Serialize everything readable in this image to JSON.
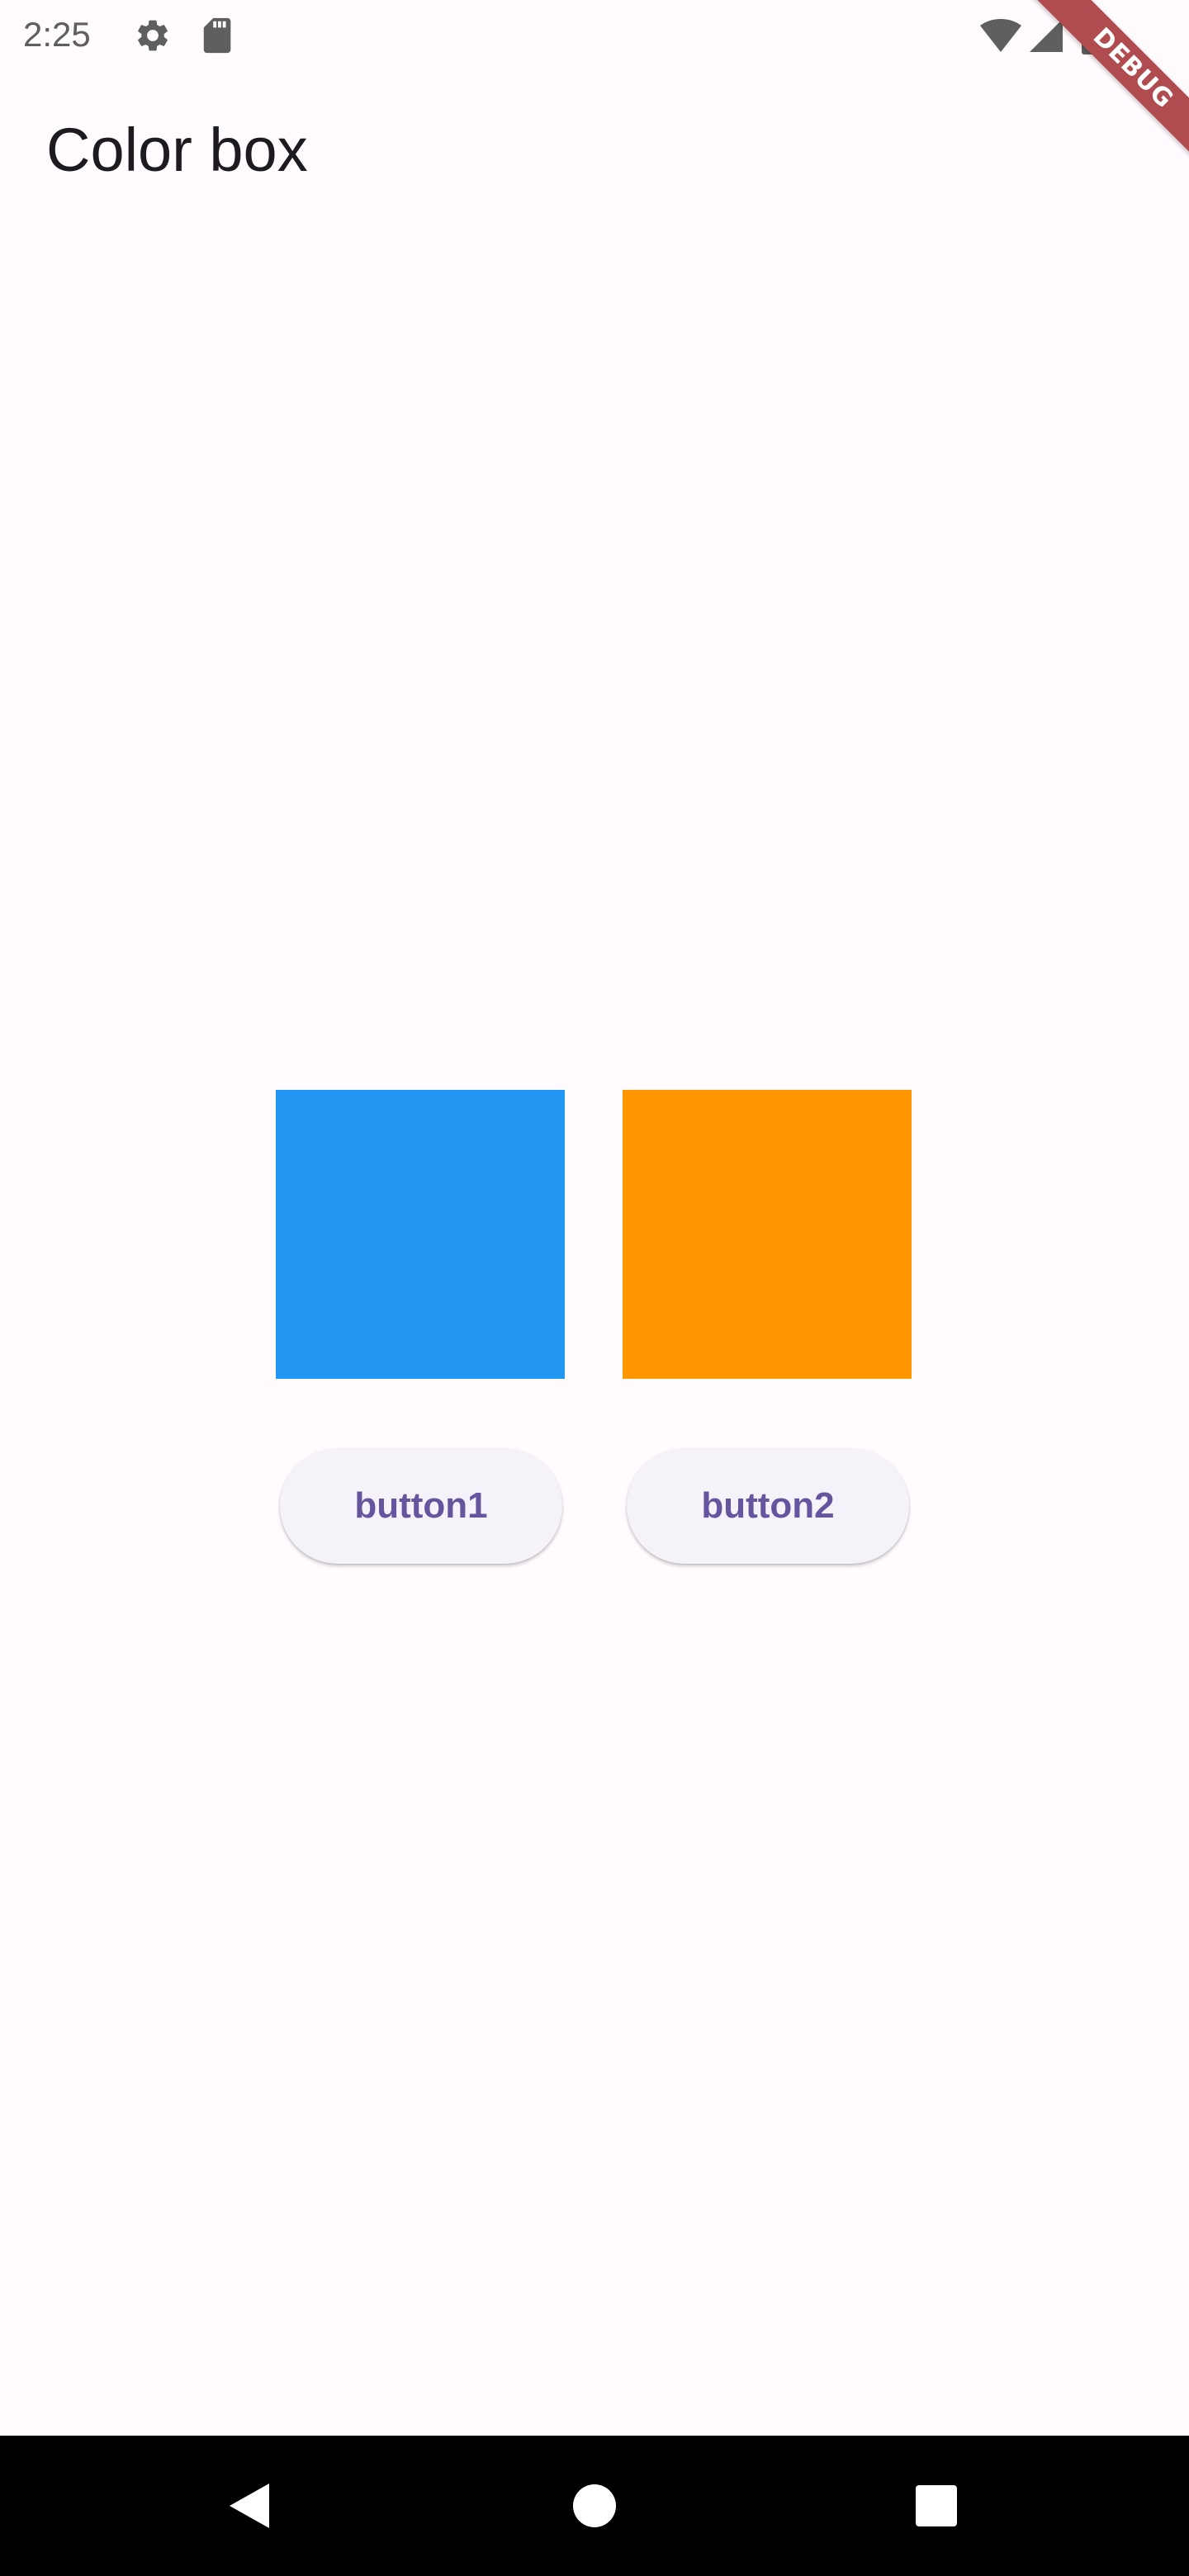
{
  "status_bar": {
    "time": "2:25",
    "icons": [
      "gear-icon",
      "sd-card-icon",
      "wifi-icon",
      "cell-signal-icon",
      "battery-icon"
    ]
  },
  "debug_banner": {
    "label": "DEBUG",
    "color": "#b04c4f"
  },
  "app_bar": {
    "title": "Color box"
  },
  "boxes": [
    {
      "name": "blue",
      "color": "#2196f3"
    },
    {
      "name": "orange",
      "color": "#ff9800"
    }
  ],
  "buttons": [
    {
      "label": "button1"
    },
    {
      "label": "button2"
    }
  ],
  "nav_bar": {
    "items": [
      "back-icon",
      "home-icon",
      "recents-icon"
    ]
  },
  "colors": {
    "background": "#fffbfe",
    "button_background": "#f6f2f9",
    "button_text": "#65559f"
  }
}
